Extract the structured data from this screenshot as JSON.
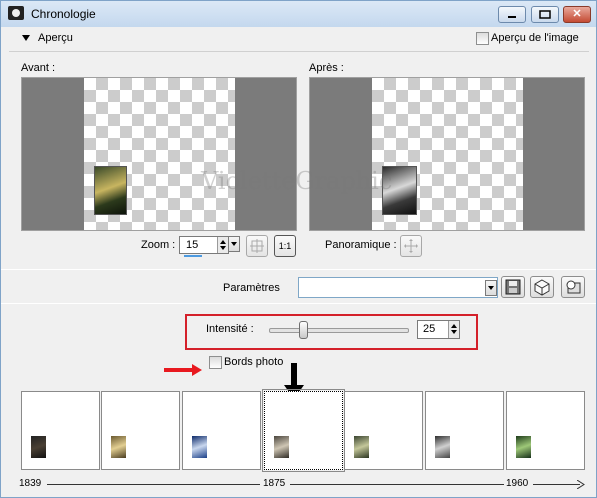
{
  "window": {
    "title": "Chronologie",
    "icon": "camera-icon"
  },
  "titlebar_buttons": {
    "minimize": "minimize-icon",
    "maximize": "maximize-icon",
    "close": "close-icon",
    "close_glyph": "✕"
  },
  "preview_toggle": {
    "label": "Aperçu",
    "icon": "triangle-down-icon"
  },
  "image_preview_checkbox": {
    "label": "Aperçu de l'image",
    "checked": false
  },
  "before": {
    "label": "Avant :"
  },
  "after": {
    "label": "Après :"
  },
  "watermark": "VioletteGraphic",
  "zoom": {
    "label": "Zoom :",
    "value": "15"
  },
  "fit_button": {
    "icon": "fit-to-window-icon"
  },
  "actual_size_button": {
    "icon": "actual-size-icon",
    "text": "1:1"
  },
  "pan": {
    "label": "Panoramique :",
    "icon": "pan-icon"
  },
  "settings": {
    "label": "Paramètres",
    "value": "",
    "save_icon": "save-icon",
    "randomize_icon": "dice-icon",
    "manage_icon": "manage-presets-icon"
  },
  "intensity": {
    "label": "Intensité :",
    "value": "25",
    "fraction": 0.23
  },
  "photo_edges": {
    "label": "Bords photo",
    "checked": false
  },
  "timeline": {
    "thumbnails": [
      {
        "tone": "#4a4034"
      },
      {
        "tone": "#b49a5a"
      },
      {
        "tone": "#2f55a0"
      },
      {
        "tone": "#8a8478",
        "selected": true
      },
      {
        "tone": "#6d7a58"
      },
      {
        "tone": "#8d8d8d"
      },
      {
        "tone": "#3f7a3a"
      }
    ],
    "labels": [
      "1839",
      "1875",
      "1960"
    ]
  },
  "colors": {
    "highlight_red": "#d4202a",
    "accent_blue": "#4d9ae0"
  }
}
